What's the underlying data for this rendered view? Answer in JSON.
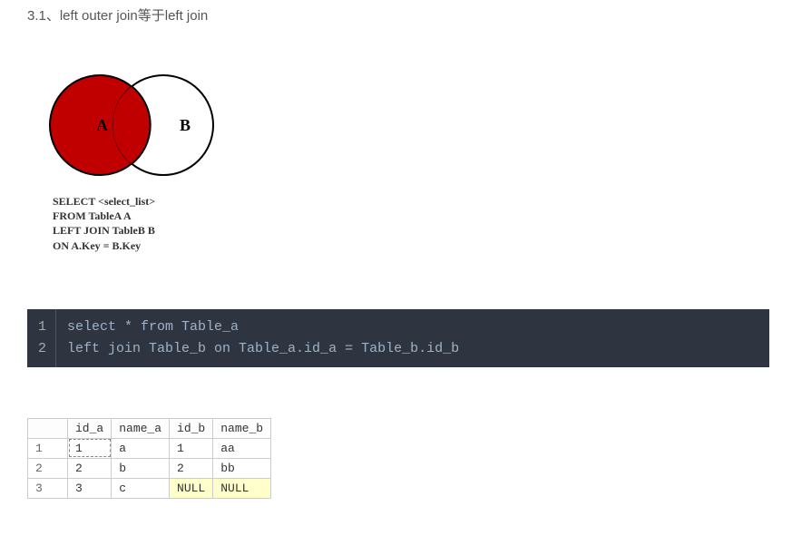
{
  "heading": "3.1、left outer join等于left join",
  "venn": {
    "labelA": "A",
    "labelB": "B",
    "caption_l1": "SELECT <select_list>",
    "caption_l2": "FROM TableA A",
    "caption_l3": "LEFT JOIN TableB B",
    "caption_l4": "ON A.Key = B.Key"
  },
  "code": {
    "ln1": "1",
    "ln2": "2",
    "line1": "select * from Table_a",
    "line2": "left join Table_b on Table_a.id_a = Table_b.id_b"
  },
  "table": {
    "blankhead": "",
    "h1": "id_a",
    "h2": "name_a",
    "h3": "id_b",
    "h4": "name_b",
    "rows": [
      {
        "n": "1",
        "c1": "1",
        "c2": "a",
        "c3": "1",
        "c4": "aa"
      },
      {
        "n": "2",
        "c1": "2",
        "c2": "b",
        "c3": "2",
        "c4": "bb"
      },
      {
        "n": "3",
        "c1": "3",
        "c2": "c",
        "c3": "NULL",
        "c4": "NULL"
      }
    ]
  }
}
